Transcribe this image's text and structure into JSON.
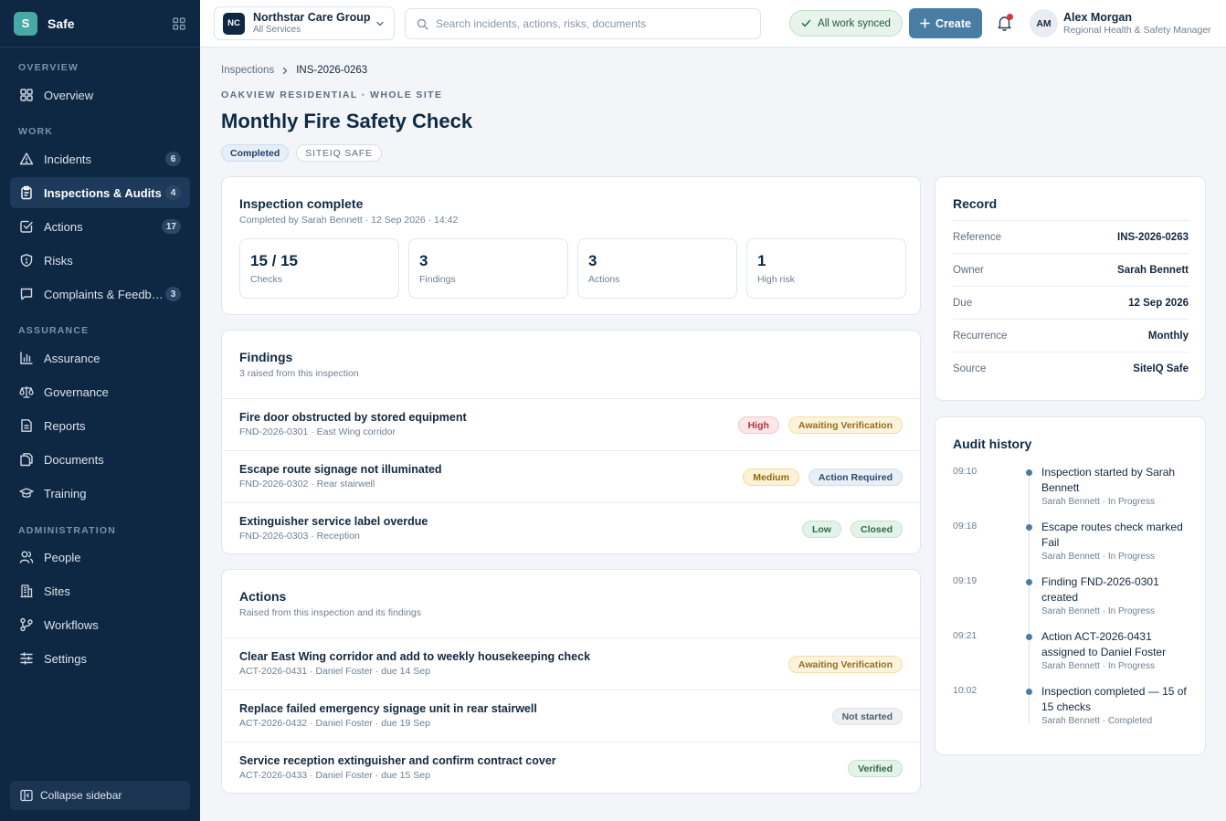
{
  "brand": {
    "logo_letter": "S",
    "name": "Safe"
  },
  "sidebar": {
    "sections": {
      "overview": "OVERVIEW",
      "work": "WORK",
      "assurance": "ASSURANCE",
      "administration": "ADMINISTRATION"
    },
    "items": [
      {
        "label": "Overview",
        "icon": "grid-icon"
      },
      {
        "label": "Incidents",
        "icon": "warning-triangle-icon",
        "badge": "6"
      },
      {
        "label": "Inspections & Audits",
        "icon": "clipboard-icon",
        "badge": "4",
        "active": true
      },
      {
        "label": "Actions",
        "icon": "checkbox-icon",
        "badge": "17"
      },
      {
        "label": "Risks",
        "icon": "shield-icon"
      },
      {
        "label": "Complaints & Feedback",
        "icon": "chat-icon",
        "badge": "3"
      },
      {
        "label": "Assurance",
        "icon": "bar-chart-icon"
      },
      {
        "label": "Governance",
        "icon": "scales-icon"
      },
      {
        "label": "Reports",
        "icon": "report-icon"
      },
      {
        "label": "Documents",
        "icon": "documents-icon"
      },
      {
        "label": "Training",
        "icon": "graduation-cap-icon"
      },
      {
        "label": "People",
        "icon": "people-icon"
      },
      {
        "label": "Sites",
        "icon": "building-icon"
      },
      {
        "label": "Workflows",
        "icon": "workflow-icon"
      },
      {
        "label": "Settings",
        "icon": "sliders-icon"
      }
    ],
    "collapse_label": "Collapse sidebar"
  },
  "topbar": {
    "org": {
      "initials": "NC",
      "name": "Northstar Care Group",
      "sub": "All Services"
    },
    "search_placeholder": "Search incidents, actions, risks, documents",
    "sync_status": "All work synced",
    "create_label": "Create",
    "user": {
      "initials": "AM",
      "name": "Alex Morgan",
      "role": "Regional Health & Safety Manager"
    }
  },
  "breadcrumb": {
    "parent": "Inspections",
    "current": "INS-2026-0263"
  },
  "page": {
    "eyebrow": "OAKVIEW RESIDENTIAL · WHOLE SITE",
    "title": "Monthly Fire Safety Check",
    "tags": {
      "status": "Completed",
      "source": "SITEIQ SAFE"
    }
  },
  "summary": {
    "title": "Inspection complete",
    "sub": "Completed by Sarah Bennett · 12 Sep 2026 · 14:42",
    "stats": [
      {
        "value": "15 / 15",
        "label": "Checks"
      },
      {
        "value": "3",
        "label": "Findings"
      },
      {
        "value": "3",
        "label": "Actions"
      },
      {
        "value": "1",
        "label": "High risk"
      }
    ]
  },
  "findings": {
    "title": "Findings",
    "sub": "3 raised from this inspection",
    "rows": [
      {
        "title": "Fire door obstructed by stored equipment",
        "meta": "FND-2026-0301 · East Wing corridor",
        "severity": "High",
        "status": "Awaiting Verification"
      },
      {
        "title": "Escape route signage not illuminated",
        "meta": "FND-2026-0302 · Rear stairwell",
        "severity": "Medium",
        "status": "Action Required"
      },
      {
        "title": "Extinguisher service label overdue",
        "meta": "FND-2026-0303 · Reception",
        "severity": "Low",
        "status": "Closed"
      }
    ]
  },
  "actions": {
    "title": "Actions",
    "sub": "Raised from this inspection and its findings",
    "rows": [
      {
        "title": "Clear East Wing corridor and add to weekly housekeeping check",
        "meta": "ACT-2026-0431 · Daniel Foster · due 14 Sep",
        "status": "Awaiting Verification"
      },
      {
        "title": "Replace failed emergency signage unit in rear stairwell",
        "meta": "ACT-2026-0432 · Daniel Foster · due 19 Sep",
        "status": "Not started"
      },
      {
        "title": "Service reception extinguisher and confirm contract cover",
        "meta": "ACT-2026-0433 · Daniel Foster · due 15 Sep",
        "status": "Verified"
      }
    ]
  },
  "record": {
    "title": "Record",
    "fields": [
      {
        "key": "Reference",
        "value": "INS-2026-0263"
      },
      {
        "key": "Owner",
        "value": "Sarah Bennett"
      },
      {
        "key": "Due",
        "value": "12 Sep 2026"
      },
      {
        "key": "Recurrence",
        "value": "Monthly"
      },
      {
        "key": "Source",
        "value": "SiteIQ Safe"
      }
    ]
  },
  "audit": {
    "title": "Audit history",
    "events": [
      {
        "time": "09:10",
        "text": "Inspection started by Sarah Bennett",
        "meta": "Sarah Bennett · In Progress"
      },
      {
        "time": "09:18",
        "text": "Escape routes check marked Fail",
        "meta": "Sarah Bennett · In Progress"
      },
      {
        "time": "09:19",
        "text": "Finding FND-2026-0301 created",
        "meta": "Sarah Bennett · In Progress"
      },
      {
        "time": "09:21",
        "text": "Action ACT-2026-0431 assigned to Daniel Foster",
        "meta": "Sarah Bennett · In Progress"
      },
      {
        "time": "10:02",
        "text": "Inspection completed — 15 of 15 checks",
        "meta": "Sarah Bennett · Completed"
      }
    ]
  },
  "colors": {
    "sidebar_bg": "#0e2742",
    "accent": "#4a7da4",
    "brand": "#49a8a4",
    "high": "#b2343b",
    "warning": "#94701a",
    "success": "#2d6a47"
  }
}
